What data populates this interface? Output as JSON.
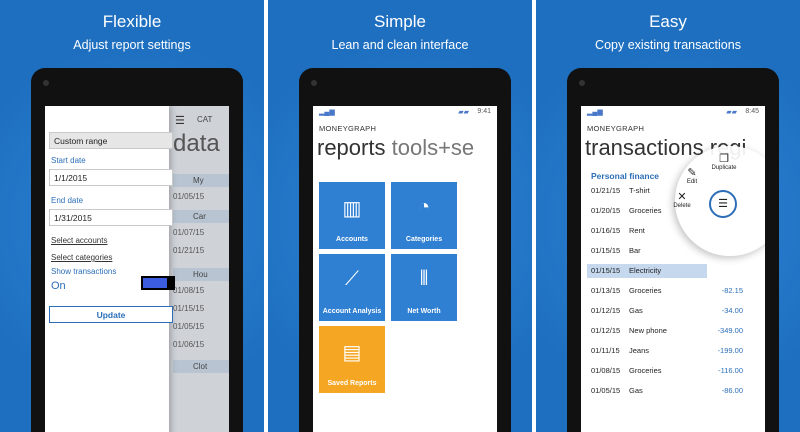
{
  "panels": [
    {
      "heading": "Flexible",
      "subheading": "Adjust report settings"
    },
    {
      "heading": "Simple",
      "subheading": "Lean and clean interface"
    },
    {
      "heading": "Easy",
      "subheading": "Copy existing transactions"
    }
  ],
  "settings": {
    "range_value": "Custom range",
    "start_label": "Start date",
    "start_value": "1/1/2015",
    "end_label": "End date",
    "end_value": "1/31/2015",
    "select_accounts": "Select accounts",
    "select_categories": "Select categories",
    "show_transactions_label": "Show transactions",
    "show_transactions_state": "On",
    "update_button": "Update",
    "background": {
      "header": "CAT",
      "title": "data",
      "rows": [
        {
          "kind": "group",
          "text": "My"
        },
        {
          "kind": "row",
          "text": "01/05/15"
        },
        {
          "kind": "group",
          "text": "Car"
        },
        {
          "kind": "row",
          "text": "01/07/15"
        },
        {
          "kind": "row",
          "text": "01/21/15"
        },
        {
          "kind": "group",
          "text": "Hou"
        },
        {
          "kind": "row",
          "text": "01/08/15"
        },
        {
          "kind": "row",
          "text": "01/15/15"
        },
        {
          "kind": "row",
          "text": "01/05/15"
        },
        {
          "kind": "row",
          "text": "01/06/15"
        },
        {
          "kind": "group",
          "text": "Clot"
        }
      ]
    }
  },
  "reports_screen": {
    "time": "9:41",
    "app_name": "MONEYGRAPH",
    "pivot_active": "reports",
    "pivot_next": "tools+se",
    "tiles": [
      {
        "label": "Accounts",
        "icon": "bar-chart-icon",
        "glyph": "▥"
      },
      {
        "label": "Categories",
        "icon": "pie-chart-icon",
        "glyph": "◔"
      },
      {
        "label": "Account Analysis",
        "icon": "line-chart-icon",
        "glyph": "⟋"
      },
      {
        "label": "Net Worth",
        "icon": "columns-icon",
        "glyph": "⦀"
      },
      {
        "label": "Saved Reports",
        "icon": "save-icon",
        "glyph": "▤",
        "color": "#f5a623"
      }
    ],
    "tile_color": "#2f7fd2"
  },
  "transactions_screen": {
    "time": "8:45",
    "app_name": "MONEYGRAPH",
    "pivot_active": "transactions",
    "pivot_next": "regi",
    "filter": "Personal finance",
    "rows": [
      {
        "date": "01/21/15",
        "name": "T-shirt",
        "amount": ""
      },
      {
        "date": "01/20/15",
        "name": "Groceries",
        "amount": ""
      },
      {
        "date": "01/16/15",
        "name": "Rent",
        "amount": ""
      },
      {
        "date": "01/15/15",
        "name": "Bar",
        "amount": ""
      },
      {
        "date": "01/15/15",
        "name": "Electricity",
        "amount": ""
      },
      {
        "date": "01/13/15",
        "name": "Groceries",
        "amount": "-82.15"
      },
      {
        "date": "01/12/15",
        "name": "Gas",
        "amount": "-34.00"
      },
      {
        "date": "01/12/15",
        "name": "New phone",
        "amount": "-349.00"
      },
      {
        "date": "01/11/15",
        "name": "Jeans",
        "amount": "-199.00"
      },
      {
        "date": "01/08/15",
        "name": "Groceries",
        "amount": "-116.00"
      },
      {
        "date": "01/05/15",
        "name": "Gas",
        "amount": "-86.00"
      }
    ],
    "context_menu": {
      "edit": "Edit",
      "duplicate": "Duplicate",
      "delete": "Delete"
    },
    "app_bar_icons": [
      "add-icon",
      "photo-icon",
      "grid-icon",
      "pin-icon"
    ],
    "accent": "#2c6fb8"
  },
  "colors": {
    "panel_bg": "#1e6fc0",
    "accent": "#2c6fb8"
  }
}
